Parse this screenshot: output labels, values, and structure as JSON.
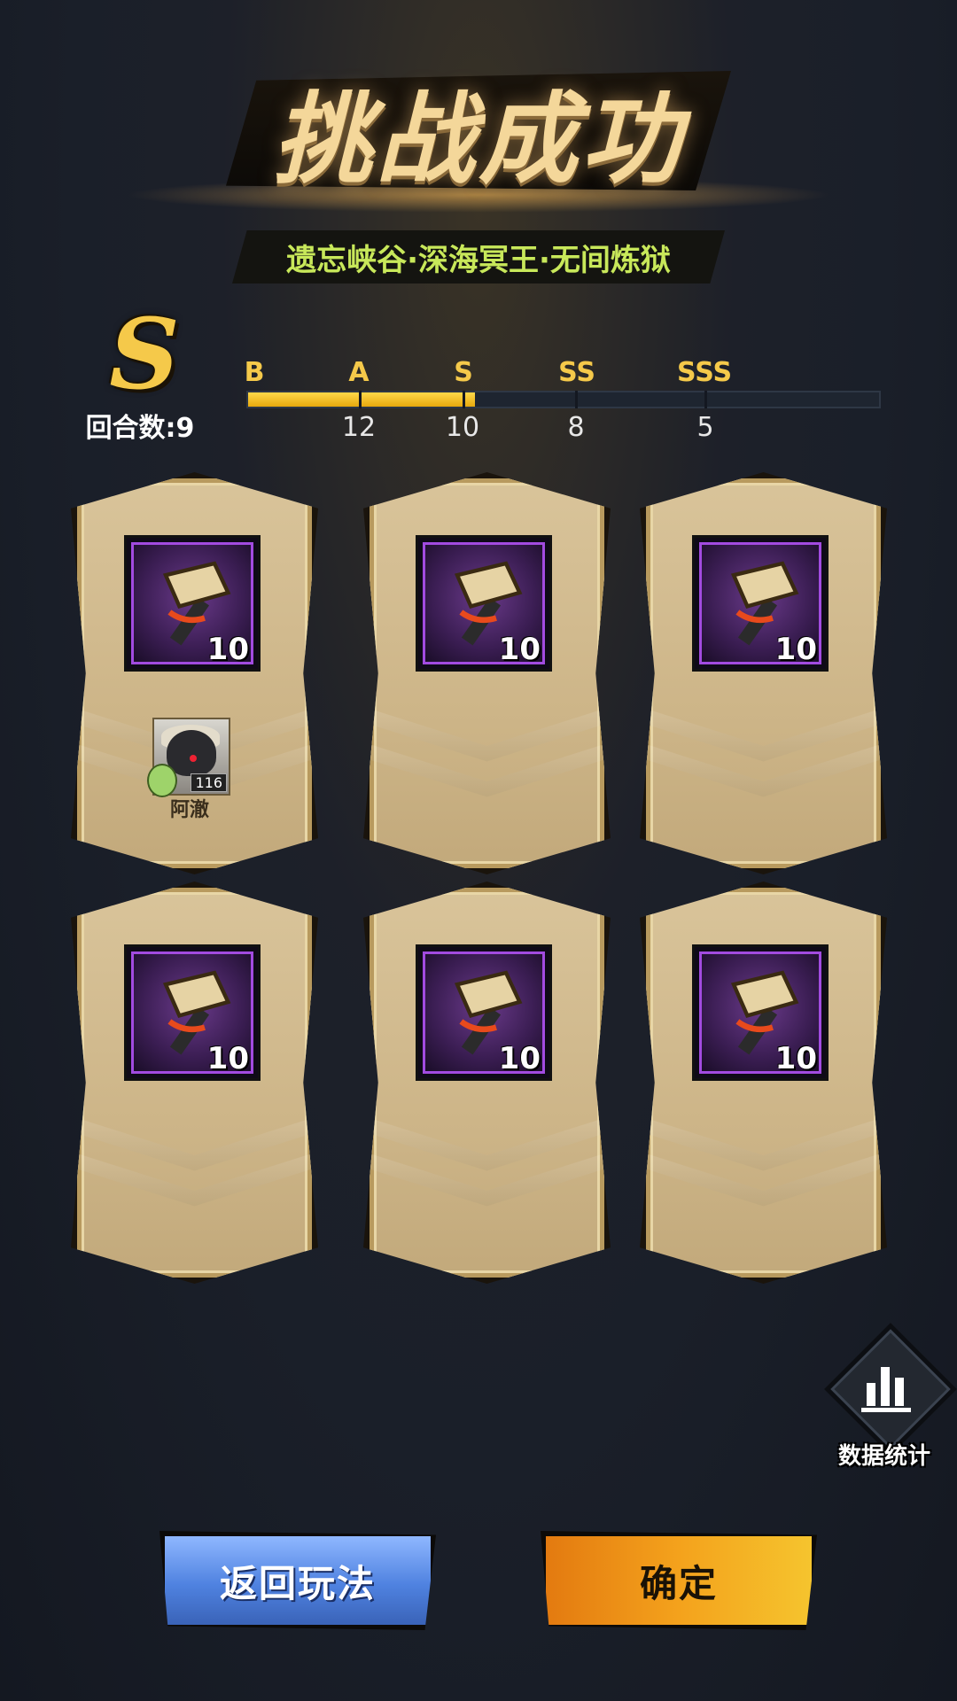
{
  "header": {
    "title": "挑战成功",
    "subtitle": "遗忘峡谷·深海冥王·无间炼狱"
  },
  "result": {
    "grade": "S",
    "turn_count": "回合数:9"
  },
  "rank_bar": {
    "labels": [
      "B",
      "A",
      "S",
      "SS",
      "SSS"
    ],
    "thresholds": [
      "12",
      "10",
      "8",
      "5"
    ],
    "fill_fraction": 0.36,
    "fill_color": "#f5c02a"
  },
  "rewards": [
    {
      "icon": "hammer-icon",
      "quantity": "10"
    },
    {
      "icon": "hammer-icon",
      "quantity": "10"
    },
    {
      "icon": "hammer-icon",
      "quantity": "10"
    },
    {
      "icon": "hammer-icon",
      "quantity": "10"
    },
    {
      "icon": "hammer-icon",
      "quantity": "10"
    },
    {
      "icon": "hammer-icon",
      "quantity": "10"
    }
  ],
  "hero": {
    "name": "阿澈",
    "level": "116"
  },
  "stats_button": {
    "label": "数据统计",
    "icon": "bar-chart-icon"
  },
  "buttons": {
    "back": "返回玩法",
    "confirm": "确定"
  },
  "colors": {
    "accent_gold": "#f5c94a",
    "subtitle_green": "#c8e85a",
    "back_blue": "#4f82e0",
    "confirm_orange": "#f4a21c",
    "item_purple": "#a24be0"
  }
}
